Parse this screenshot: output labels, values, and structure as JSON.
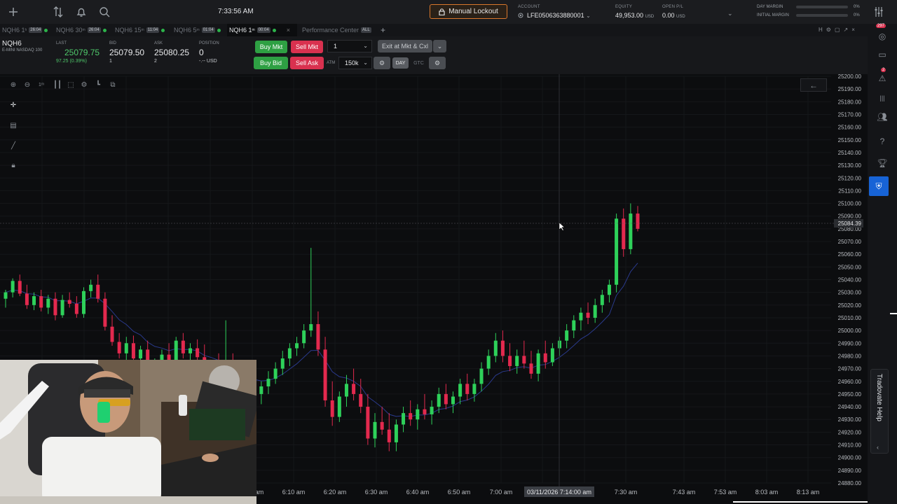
{
  "topbar": {
    "clock": "7:33:56 AM",
    "lockout_label": "Manual Lockout",
    "account_label": "ACCOUNT",
    "account_value": "LFE0506363880001",
    "equity_label": "EQUITY",
    "equity_value": "49,953.00",
    "equity_unit": "USD",
    "openpl_label": "OPEN P/L",
    "openpl_value": "0.00",
    "openpl_unit": "USD",
    "day_margin_label": "DAY MARGIN",
    "day_margin_pct": "0%",
    "day_margin_fraction": 0,
    "initial_margin_label": "INITIAL MARGIN",
    "initial_margin_pct": "0%",
    "initial_margin_fraction": 0,
    "icons": [
      "plus-icon",
      "sort-arrows-icon",
      "bell-icon",
      "search-icon",
      "lock-icon",
      "chevron-down-icon",
      "settings-sliders-icon"
    ]
  },
  "tabs": [
    {
      "name": "NQH6 1",
      "sup": "h",
      "badge": "26:04",
      "active": false
    },
    {
      "name": "NQH6 30",
      "sup": "m",
      "badge": "26:04",
      "active": false
    },
    {
      "name": "NQH6 15",
      "sup": "m",
      "badge": "11:04",
      "active": false
    },
    {
      "name": "NQH6 5",
      "sup": "m",
      "badge": "01:04",
      "active": false
    },
    {
      "name": "NQH6 1",
      "sup": "m",
      "badge": "00:04",
      "active": true
    },
    {
      "name": "Performance Center",
      "sup": "",
      "badge": "ALL",
      "active": false
    }
  ],
  "quote": {
    "symbol": "NQH6",
    "description": "E-MINI NASDAQ 100",
    "last_label": "LAST",
    "last_value": "25079.75",
    "change": "97.25 (0.39%)",
    "bid_label": "BID",
    "bid_value": "25079.50",
    "bid_size": "1",
    "ask_label": "ASK",
    "ask_value": "25080.25",
    "ask_size": "2",
    "position_label": "POSITION",
    "position_value": "0",
    "position_unit": "-.-- USD"
  },
  "order": {
    "buy_mkt": "Buy Mkt",
    "sell_mkt": "Sell Mkt",
    "buy_bid": "Buy Bid",
    "sell_ask": "Sell Ask",
    "qty": "1",
    "atm_label": "ATM",
    "atm_value": "150k",
    "exit_label": "Exit at Mkt & Cxl",
    "day_label": "DAY",
    "gtc_label": "GTC"
  },
  "chart_data": {
    "type": "candlestick",
    "symbol": "NQH6",
    "interval": "1m",
    "ylim": [
      24880,
      25200
    ],
    "y_ticks": [
      25200,
      25190,
      25180,
      25170,
      25160,
      25150,
      25140,
      25130,
      25120,
      25110,
      25100,
      25090,
      25080,
      25070,
      25060,
      25050,
      25040,
      25030,
      25020,
      25010,
      25000,
      24990,
      24980,
      24970,
      24960,
      24950,
      24940,
      24930,
      24920,
      24910,
      24900,
      24890,
      24880
    ],
    "x_ticks": [
      "6:10 am",
      "6:20 am",
      "6:30 am",
      "6:40 am",
      "6:50 am",
      "7:00 am",
      "7:30 am",
      "7:43 am",
      "7:53 am",
      "8:03 am",
      "8:13 am"
    ],
    "x_tick_partial": "am",
    "crosshair_time_label": "03/11/2026 7:14:00 am",
    "crosshair_price_label": "25084.39",
    "candles": [
      [
        25025,
        25032,
        25018,
        25030
      ],
      [
        25030,
        25041,
        25026,
        25039
      ],
      [
        25039,
        25044,
        25027,
        25029
      ],
      [
        25029,
        25036,
        25017,
        25020
      ],
      [
        25020,
        25030,
        25016,
        25027
      ],
      [
        25027,
        25032,
        25015,
        25018
      ],
      [
        25018,
        25028,
        25013,
        25025
      ],
      [
        25025,
        25030,
        25008,
        25012
      ],
      [
        25012,
        25028,
        25010,
        25024
      ],
      [
        25024,
        25030,
        25018,
        25021
      ],
      [
        25021,
        25027,
        25010,
        25013
      ],
      [
        25013,
        25034,
        25010,
        25031
      ],
      [
        25031,
        25040,
        25026,
        25036
      ],
      [
        25036,
        25044,
        25022,
        25025
      ],
      [
        25025,
        25030,
        25000,
        25003
      ],
      [
        25003,
        25012,
        24988,
        24991
      ],
      [
        24991,
        24998,
        24978,
        24982
      ],
      [
        24982,
        24995,
        24976,
        24990
      ],
      [
        24990,
        24996,
        24975,
        24978
      ],
      [
        24978,
        24988,
        24970,
        24985
      ],
      [
        24985,
        24992,
        24965,
        24968
      ],
      [
        24968,
        24978,
        24960,
        24974
      ],
      [
        24974,
        24985,
        24968,
        24981
      ],
      [
        24981,
        24990,
        24972,
        24976
      ],
      [
        24976,
        24995,
        24972,
        24992
      ],
      [
        24992,
        24998,
        24978,
        24982
      ],
      [
        24982,
        24990,
        24970,
        24986
      ],
      [
        24986,
        24993,
        24975,
        24979
      ],
      [
        24979,
        24989,
        24962,
        24966
      ],
      [
        24966,
        24976,
        24958,
        24972
      ],
      [
        24972,
        24982,
        24965,
        24968
      ],
      [
        24968,
        25008,
        24966,
        24972
      ],
      [
        24972,
        24982,
        24955,
        24958
      ],
      [
        24958,
        24966,
        24940,
        24945
      ],
      [
        24945,
        24960,
        24938,
        24955
      ],
      [
        24955,
        24964,
        24944,
        24950
      ],
      [
        24950,
        24960,
        24942,
        24956
      ],
      [
        24956,
        24968,
        24950,
        24962
      ],
      [
        24962,
        24975,
        24958,
        24970
      ],
      [
        24970,
        24984,
        24965,
        24978
      ],
      [
        24978,
        24990,
        24972,
        24986
      ],
      [
        24986,
        24995,
        24980,
        24990
      ],
      [
        24990,
        25005,
        24986,
        25000
      ],
      [
        25000,
        25065,
        24995,
        25005
      ],
      [
        25005,
        25015,
        24980,
        24985
      ],
      [
        24985,
        24995,
        24940,
        24945
      ],
      [
        24945,
        24960,
        24925,
        24932
      ],
      [
        24932,
        24952,
        24928,
        24948
      ],
      [
        24948,
        24965,
        24940,
        24958
      ],
      [
        24958,
        24970,
        24945,
        24950
      ],
      [
        24950,
        24962,
        24935,
        24940
      ],
      [
        24940,
        24950,
        24910,
        24915
      ],
      [
        24915,
        24935,
        24908,
        24928
      ],
      [
        24928,
        24940,
        24918,
        24922
      ],
      [
        24922,
        24935,
        24905,
        24912
      ],
      [
        24912,
        24930,
        24905,
        24926
      ],
      [
        24926,
        24940,
        24920,
        24935
      ],
      [
        24935,
        24945,
        24925,
        24930
      ],
      [
        24930,
        24942,
        24922,
        24938
      ],
      [
        24938,
        24950,
        24930,
        24934
      ],
      [
        24934,
        24945,
        24926,
        24940
      ],
      [
        24940,
        24955,
        24935,
        24950
      ],
      [
        24950,
        24958,
        24938,
        24942
      ],
      [
        24942,
        24952,
        24935,
        24948
      ],
      [
        24948,
        24962,
        24942,
        24958
      ],
      [
        24958,
        24966,
        24945,
        24950
      ],
      [
        24950,
        24962,
        24944,
        24958
      ],
      [
        24958,
        24975,
        24952,
        24970
      ],
      [
        24970,
        24985,
        24965,
        24980
      ],
      [
        24980,
        24998,
        24975,
        24992
      ],
      [
        24992,
        25000,
        24975,
        24980
      ],
      [
        24980,
        24990,
        24968,
        24972
      ],
      [
        24972,
        24985,
        24966,
        24980
      ],
      [
        24980,
        24992,
        24970,
        24974
      ],
      [
        24974,
        24984,
        24962,
        24966
      ],
      [
        24966,
        24985,
        24960,
        24982
      ],
      [
        24982,
        24992,
        24970,
        24975
      ],
      [
        24975,
        24990,
        24972,
        24986
      ],
      [
        24986,
        24995,
        24980,
        24992
      ],
      [
        24992,
        25005,
        24986,
        25000
      ],
      [
        25000,
        25012,
        24994,
        25008
      ],
      [
        25008,
        25018,
        25000,
        25014
      ],
      [
        25014,
        25022,
        25005,
        25010
      ],
      [
        25010,
        25025,
        25006,
        25020
      ],
      [
        25020,
        25032,
        25014,
        25028
      ],
      [
        25028,
        25040,
        25022,
        25036
      ],
      [
        25036,
        25092,
        25030,
        25088
      ],
      [
        25088,
        25096,
        25058,
        25064
      ],
      [
        25064,
        25100,
        25060,
        25092
      ],
      [
        25092,
        25098,
        25078,
        25080
      ]
    ]
  },
  "sidebar": {
    "notif_count": "297",
    "alert_count": "2",
    "help_label": "Tradovate Help"
  }
}
